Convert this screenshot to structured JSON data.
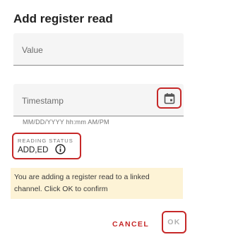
{
  "dialog": {
    "title": "Add register read",
    "value_field": {
      "placeholder": "Value"
    },
    "timestamp_field": {
      "placeholder": "Timestamp",
      "helper": "MM/DD/YYYY hh:mm AM/PM",
      "icon": "calendar-icon"
    },
    "reading_status": {
      "label": "READING STATUS",
      "value": "ADD,ED",
      "icon": "info-icon"
    },
    "notice": "You are adding a register read to a linked channel. Click OK to confirm",
    "actions": {
      "cancel": "CANCEL",
      "ok": "OK"
    },
    "colors": {
      "accent": "#c62828",
      "notice_bg": "#fdf3d6",
      "field_bg": "#f5f5f5",
      "disabled_text": "#b0b0b0"
    }
  }
}
